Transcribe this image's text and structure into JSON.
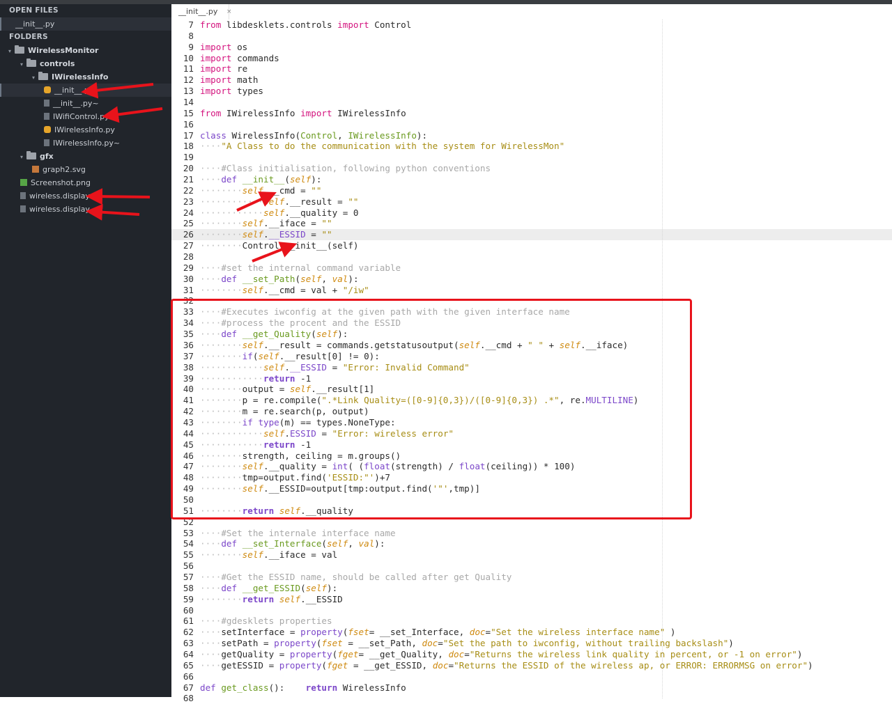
{
  "sidebar": {
    "open_files_header": "OPEN FILES",
    "open_files": [
      "__init__.py"
    ],
    "folders_header": "FOLDERS",
    "tree": [
      {
        "label": "WirelessMonitor",
        "type": "folder",
        "depth": 0
      },
      {
        "label": "controls",
        "type": "folder",
        "depth": 1
      },
      {
        "label": "IWirelessInfo",
        "type": "folder",
        "depth": 2
      },
      {
        "label": "__init__.py",
        "type": "py",
        "depth": 3,
        "selected": true
      },
      {
        "label": "__init__.py~",
        "type": "file",
        "depth": 3
      },
      {
        "label": "IWifiControl.py~",
        "type": "file",
        "depth": 3
      },
      {
        "label": "IWirelessInfo.py",
        "type": "py",
        "depth": 3
      },
      {
        "label": "IWirelessInfo.py~",
        "type": "file",
        "depth": 3
      },
      {
        "label": "gfx",
        "type": "folder",
        "depth": 1
      },
      {
        "label": "graph2.svg",
        "type": "svg",
        "depth": 2
      },
      {
        "label": "Screenshot.png",
        "type": "png",
        "depth": 1
      },
      {
        "label": "wireless.display",
        "type": "file",
        "depth": 1
      },
      {
        "label": "wireless.display~",
        "type": "file",
        "depth": 1
      }
    ]
  },
  "tab": {
    "label": "__init__.py",
    "close_icon": "×"
  },
  "colors": {
    "keyword": "#d4137e",
    "name": "#6a9a1f",
    "string": "#a78d14",
    "comment": "#a8a8a8",
    "self": "#cf8a10",
    "builtin": "#7b46c9",
    "dots": "#bdbdbd",
    "highlight": "#e8131b"
  },
  "code": [
    {
      "n": 7,
      "t": [
        [
          "k",
          "from"
        ],
        [
          "p",
          " libdesklets.controls "
        ],
        [
          "k",
          "import"
        ],
        [
          "p",
          " Control"
        ]
      ]
    },
    {
      "n": 8,
      "t": []
    },
    {
      "n": 9,
      "t": [
        [
          "k",
          "import"
        ],
        [
          "p",
          " os"
        ]
      ]
    },
    {
      "n": 10,
      "t": [
        [
          "k",
          "import"
        ],
        [
          "p",
          " commands"
        ]
      ]
    },
    {
      "n": 11,
      "t": [
        [
          "k",
          "import"
        ],
        [
          "p",
          " re"
        ]
      ]
    },
    {
      "n": 12,
      "t": [
        [
          "k",
          "import"
        ],
        [
          "p",
          " math"
        ]
      ]
    },
    {
      "n": 13,
      "t": [
        [
          "k",
          "import"
        ],
        [
          "p",
          " types"
        ]
      ]
    },
    {
      "n": 14,
      "t": []
    },
    {
      "n": 15,
      "t": [
        [
          "k",
          "from"
        ],
        [
          "p",
          " IWirelessInfo "
        ],
        [
          "k",
          "import"
        ],
        [
          "p",
          " IWirelessInfo"
        ]
      ]
    },
    {
      "n": 16,
      "t": []
    },
    {
      "n": 17,
      "t": [
        [
          "b",
          "class"
        ],
        [
          "p",
          " WirelessInfo("
        ],
        [
          "n",
          "Control"
        ],
        [
          "p",
          ", "
        ],
        [
          "n",
          "IWirelessInfo"
        ],
        [
          "p",
          "):"
        ]
      ]
    },
    {
      "n": 18,
      "t": [
        [
          "d",
          "····"
        ],
        [
          "s",
          "\"A Class to do the communication with the system for WirelessMon\""
        ]
      ]
    },
    {
      "n": 19,
      "t": []
    },
    {
      "n": 20,
      "t": [
        [
          "d",
          "····"
        ],
        [
          "c",
          "#Class initialisation, following python conventions"
        ]
      ]
    },
    {
      "n": 21,
      "t": [
        [
          "d",
          "····"
        ],
        [
          "b",
          "def"
        ],
        [
          "p",
          " "
        ],
        [
          "n",
          "__init__"
        ],
        [
          "p",
          "("
        ],
        [
          "e",
          "self"
        ],
        [
          "p",
          "):"
        ]
      ]
    },
    {
      "n": 22,
      "t": [
        [
          "d",
          "········"
        ],
        [
          "e",
          "self"
        ],
        [
          "p",
          ".__cmd = "
        ],
        [
          "s",
          "\"\""
        ]
      ]
    },
    {
      "n": 23,
      "t": [
        [
          "d",
          "············"
        ],
        [
          "e",
          "self"
        ],
        [
          "p",
          ".__result = "
        ],
        [
          "s",
          "\"\""
        ]
      ]
    },
    {
      "n": 24,
      "t": [
        [
          "d",
          "············"
        ],
        [
          "e",
          "self"
        ],
        [
          "p",
          ".__quality = 0"
        ]
      ]
    },
    {
      "n": 25,
      "t": [
        [
          "d",
          "········"
        ],
        [
          "e",
          "self"
        ],
        [
          "p",
          ".__iface = "
        ],
        [
          "s",
          "\"\""
        ]
      ]
    },
    {
      "n": 26,
      "t": [
        [
          "d",
          "········"
        ],
        [
          "e",
          "self"
        ],
        [
          "p",
          "."
        ],
        [
          "u",
          "__ESSID"
        ],
        [
          "p",
          " = "
        ],
        [
          "s",
          "\"\""
        ]
      ],
      "cur": true
    },
    {
      "n": 27,
      "t": [
        [
          "d",
          "········"
        ],
        [
          "p",
          "Control.__init__(self)"
        ]
      ]
    },
    {
      "n": 28,
      "t": []
    },
    {
      "n": 29,
      "t": [
        [
          "d",
          "····"
        ],
        [
          "c",
          "#set the internal command variable"
        ]
      ]
    },
    {
      "n": 30,
      "t": [
        [
          "d",
          "····"
        ],
        [
          "b",
          "def"
        ],
        [
          "p",
          " "
        ],
        [
          "n",
          "__set_Path"
        ],
        [
          "p",
          "("
        ],
        [
          "e",
          "self"
        ],
        [
          "p",
          ", "
        ],
        [
          "e",
          "val"
        ],
        [
          "p",
          "):"
        ]
      ]
    },
    {
      "n": 31,
      "t": [
        [
          "d",
          "········"
        ],
        [
          "e",
          "self"
        ],
        [
          "p",
          ".__cmd = val + "
        ],
        [
          "s",
          "\"/iw\""
        ]
      ]
    },
    {
      "n": 32,
      "t": []
    },
    {
      "n": 33,
      "t": [
        [
          "d",
          "····"
        ],
        [
          "c",
          "#Executes iwconfig at the given path with the given interface name"
        ]
      ]
    },
    {
      "n": 34,
      "t": [
        [
          "d",
          "····"
        ],
        [
          "c",
          "#process the procent and the ESSID"
        ]
      ]
    },
    {
      "n": 35,
      "t": [
        [
          "d",
          "····"
        ],
        [
          "b",
          "def"
        ],
        [
          "p",
          " "
        ],
        [
          "n",
          "__get_Quality"
        ],
        [
          "p",
          "("
        ],
        [
          "e",
          "self"
        ],
        [
          "p",
          "):"
        ]
      ]
    },
    {
      "n": 36,
      "t": [
        [
          "d",
          "········"
        ],
        [
          "e",
          "self"
        ],
        [
          "p",
          ".__result = commands.getstatusoutput("
        ],
        [
          "e",
          "self"
        ],
        [
          "p",
          ".__cmd + "
        ],
        [
          "s",
          "\" \""
        ],
        [
          "p",
          " + "
        ],
        [
          "e",
          "self"
        ],
        [
          "p",
          ".__iface)"
        ]
      ]
    },
    {
      "n": 37,
      "t": [
        [
          "d",
          "········"
        ],
        [
          "b",
          "if"
        ],
        [
          "p",
          "("
        ],
        [
          "e",
          "self"
        ],
        [
          "p",
          ".__result[0] != 0):"
        ]
      ]
    },
    {
      "n": 38,
      "t": [
        [
          "d",
          "············"
        ],
        [
          "e",
          "self"
        ],
        [
          "p",
          "."
        ],
        [
          "u",
          "__ESSID"
        ],
        [
          "p",
          " = "
        ],
        [
          "s",
          "\"Error: Invalid Command\""
        ]
      ]
    },
    {
      "n": 39,
      "t": [
        [
          "d",
          "············"
        ],
        [
          "b",
          "return"
        ],
        [
          "p",
          " -1"
        ]
      ]
    },
    {
      "n": 40,
      "t": [
        [
          "d",
          "········"
        ],
        [
          "p",
          "output = "
        ],
        [
          "e",
          "self"
        ],
        [
          "p",
          ".__result[1]"
        ]
      ]
    },
    {
      "n": 41,
      "t": [
        [
          "d",
          "········"
        ],
        [
          "p",
          "p = re.compile("
        ],
        [
          "s",
          "\".*Link Quality=([0-9]{0,3})/([0-9]{0,3}) .*\""
        ],
        [
          "p",
          ", re."
        ],
        [
          "u",
          "MULTILINE"
        ],
        [
          "p",
          ")"
        ]
      ]
    },
    {
      "n": 42,
      "t": [
        [
          "d",
          "········"
        ],
        [
          "p",
          "m = re.search(p, output)"
        ]
      ]
    },
    {
      "n": 43,
      "t": [
        [
          "d",
          "········"
        ],
        [
          "b",
          "if"
        ],
        [
          "p",
          " "
        ],
        [
          "u",
          "type"
        ],
        [
          "p",
          "(m) == types.NoneType:"
        ]
      ]
    },
    {
      "n": 44,
      "t": [
        [
          "d",
          "············"
        ],
        [
          "e",
          "self"
        ],
        [
          "p",
          "."
        ],
        [
          "u",
          "ESSID"
        ],
        [
          "p",
          " = "
        ],
        [
          "s",
          "\"Error: wireless error\""
        ]
      ]
    },
    {
      "n": 45,
      "t": [
        [
          "d",
          "············"
        ],
        [
          "b",
          "return"
        ],
        [
          "p",
          " -1"
        ]
      ]
    },
    {
      "n": 46,
      "t": [
        [
          "d",
          "········"
        ],
        [
          "p",
          "strength, ceiling = m.groups()"
        ]
      ]
    },
    {
      "n": 47,
      "t": [
        [
          "d",
          "········"
        ],
        [
          "e",
          "self"
        ],
        [
          "p",
          ".__quality = "
        ],
        [
          "u",
          "int"
        ],
        [
          "p",
          "( ("
        ],
        [
          "u",
          "float"
        ],
        [
          "p",
          "(strength) / "
        ],
        [
          "u",
          "float"
        ],
        [
          "p",
          "(ceiling)) * 100)"
        ]
      ]
    },
    {
      "n": 48,
      "t": [
        [
          "d",
          "········"
        ],
        [
          "p",
          "tmp=output.find("
        ],
        [
          "s",
          "'ESSID:\"'"
        ],
        [
          "p",
          ")+7"
        ]
      ]
    },
    {
      "n": 49,
      "t": [
        [
          "d",
          "········"
        ],
        [
          "e",
          "self"
        ],
        [
          "p",
          ".__ESSID=output[tmp:output.find("
        ],
        [
          "s",
          "'\"'"
        ],
        [
          "p",
          ",tmp)]"
        ]
      ]
    },
    {
      "n": 50,
      "t": []
    },
    {
      "n": 51,
      "t": [
        [
          "d",
          "········"
        ],
        [
          "b",
          "return"
        ],
        [
          "p",
          " "
        ],
        [
          "e",
          "self"
        ],
        [
          "p",
          ".__quality"
        ]
      ]
    },
    {
      "n": 52,
      "t": []
    },
    {
      "n": 53,
      "t": [
        [
          "d",
          "····"
        ],
        [
          "c",
          "#Set the internale interface name"
        ]
      ]
    },
    {
      "n": 54,
      "t": [
        [
          "d",
          "····"
        ],
        [
          "b",
          "def"
        ],
        [
          "p",
          " "
        ],
        [
          "n",
          "__set_Interface"
        ],
        [
          "p",
          "("
        ],
        [
          "e",
          "self"
        ],
        [
          "p",
          ", "
        ],
        [
          "e",
          "val"
        ],
        [
          "p",
          "):"
        ]
      ]
    },
    {
      "n": 55,
      "t": [
        [
          "d",
          "········"
        ],
        [
          "e",
          "self"
        ],
        [
          "p",
          ".__iface = val"
        ]
      ]
    },
    {
      "n": 56,
      "t": []
    },
    {
      "n": 57,
      "t": [
        [
          "d",
          "····"
        ],
        [
          "c",
          "#Get the ESSID name, should be called after get Quality"
        ]
      ]
    },
    {
      "n": 58,
      "t": [
        [
          "d",
          "····"
        ],
        [
          "b",
          "def"
        ],
        [
          "p",
          " "
        ],
        [
          "n",
          "__get_ESSID"
        ],
        [
          "p",
          "("
        ],
        [
          "e",
          "self"
        ],
        [
          "p",
          "):"
        ]
      ]
    },
    {
      "n": 59,
      "t": [
        [
          "d",
          "········"
        ],
        [
          "b",
          "return"
        ],
        [
          "p",
          " "
        ],
        [
          "e",
          "self"
        ],
        [
          "p",
          ".__ESSID"
        ]
      ]
    },
    {
      "n": 60,
      "t": []
    },
    {
      "n": 61,
      "t": [
        [
          "d",
          "····"
        ],
        [
          "c",
          "#gdesklets properties"
        ]
      ]
    },
    {
      "n": 62,
      "t": [
        [
          "d",
          "····"
        ],
        [
          "p",
          "setInterface = "
        ],
        [
          "u",
          "property"
        ],
        [
          "p",
          "("
        ],
        [
          "e",
          "fset"
        ],
        [
          "p",
          "= __set_Interface, "
        ],
        [
          "e",
          "doc"
        ],
        [
          "p",
          "="
        ],
        [
          "s",
          "\"Set the wireless interface name\""
        ],
        [
          "p",
          " )"
        ]
      ]
    },
    {
      "n": 63,
      "t": [
        [
          "d",
          "····"
        ],
        [
          "p",
          "setPath = "
        ],
        [
          "u",
          "property"
        ],
        [
          "p",
          "("
        ],
        [
          "e",
          "fset"
        ],
        [
          "p",
          " = __set_Path, "
        ],
        [
          "e",
          "doc"
        ],
        [
          "p",
          "="
        ],
        [
          "s",
          "\"Set the path to iwconfig, without trailing backslash\""
        ],
        [
          "p",
          ")"
        ]
      ]
    },
    {
      "n": 64,
      "t": [
        [
          "d",
          "····"
        ],
        [
          "p",
          "getQuality = "
        ],
        [
          "u",
          "property"
        ],
        [
          "p",
          "("
        ],
        [
          "e",
          "fget"
        ],
        [
          "p",
          "= __get_Quality, "
        ],
        [
          "e",
          "doc"
        ],
        [
          "p",
          "="
        ],
        [
          "s",
          "\"Returns the wireless link quality in percent, or -1 on error\""
        ],
        [
          "p",
          ")"
        ]
      ]
    },
    {
      "n": 65,
      "t": [
        [
          "d",
          "····"
        ],
        [
          "p",
          "getESSID = "
        ],
        [
          "u",
          "property"
        ],
        [
          "p",
          "("
        ],
        [
          "e",
          "fget"
        ],
        [
          "p",
          " = __get_ESSID, "
        ],
        [
          "e",
          "doc"
        ],
        [
          "p",
          "="
        ],
        [
          "s",
          "\"Returns the ESSID of the wireless ap, or ERROR: ERRORMSG on error\""
        ],
        [
          "p",
          ")"
        ]
      ]
    },
    {
      "n": 66,
      "t": []
    },
    {
      "n": 67,
      "t": [
        [
          "b",
          "def"
        ],
        [
          "p",
          " "
        ],
        [
          "n",
          "get_class"
        ],
        [
          "p",
          "():    "
        ],
        [
          "b",
          "return"
        ],
        [
          "p",
          " WirelessInfo"
        ]
      ]
    },
    {
      "n": 68,
      "t": []
    }
  ]
}
